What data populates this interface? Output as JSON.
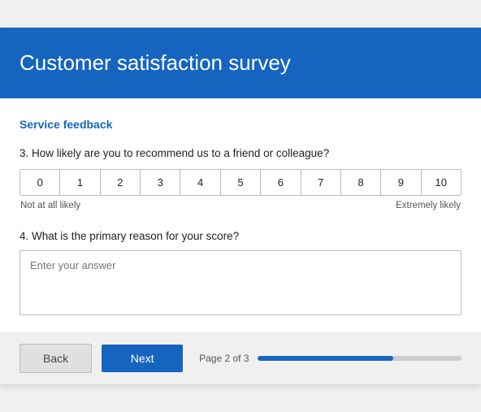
{
  "header": {
    "title": "Customer satisfaction survey"
  },
  "section": {
    "label": "Service feedback"
  },
  "question3": {
    "label": "3. How likely are you to recommend us to a friend or colleague?",
    "scale": [
      "0",
      "1",
      "2",
      "3",
      "4",
      "5",
      "6",
      "7",
      "8",
      "9",
      "10"
    ],
    "low_label": "Not at all likely",
    "high_label": "Extremely likely"
  },
  "question4": {
    "label": "4. What is the primary reason for your score?",
    "placeholder": "Enter your answer"
  },
  "footer": {
    "back_label": "Back",
    "next_label": "Next",
    "page_text": "Page 2 of 3",
    "progress_percent": 66.6
  }
}
